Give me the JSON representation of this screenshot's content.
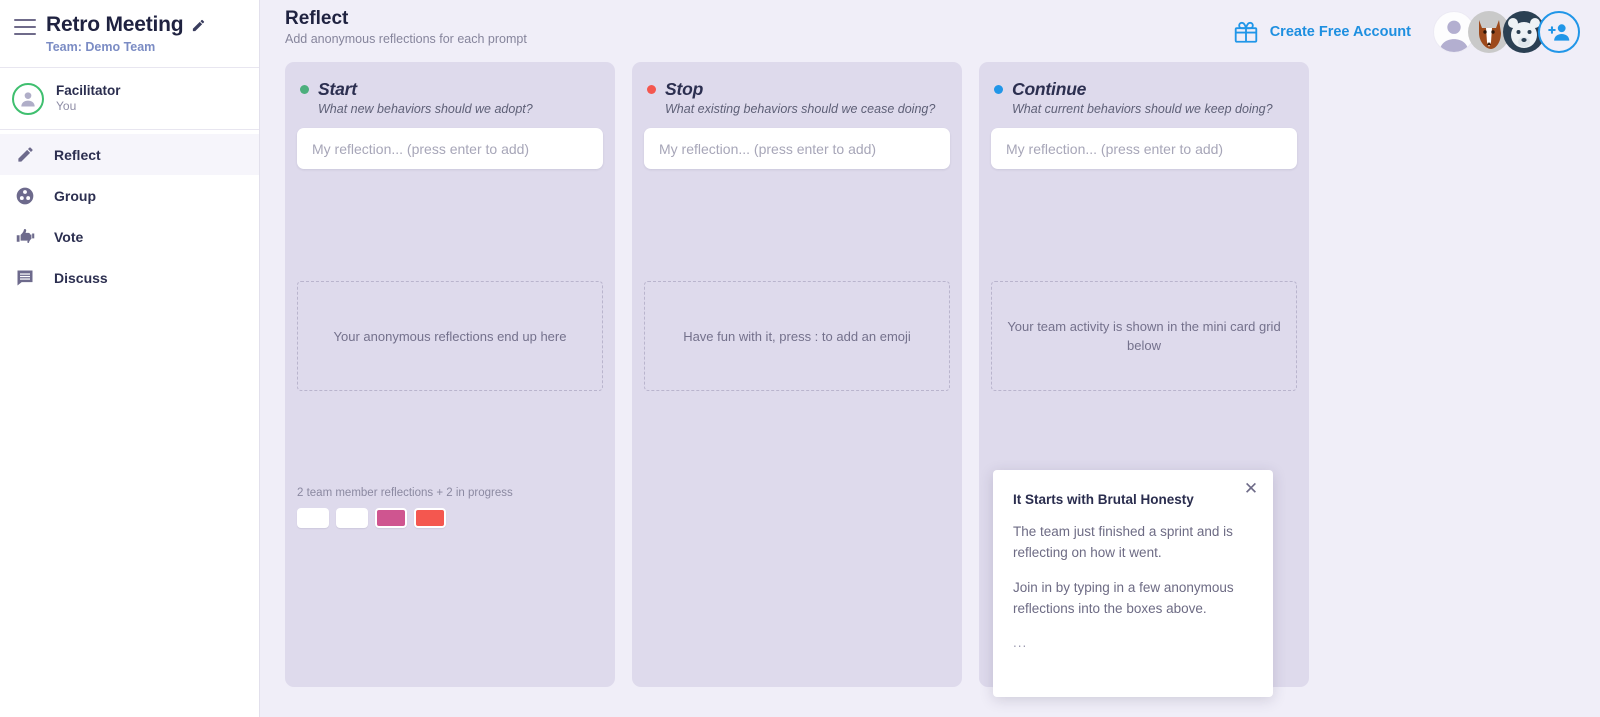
{
  "sidebar": {
    "menu_icon": "hamburger-icon",
    "retro_title": "Retro Meeting",
    "edit_icon": "pencil-icon",
    "team_line": "Team: Demo Team",
    "user": {
      "avatar_icon": "user-avatar-icon",
      "name": "Facilitator",
      "role": "You"
    },
    "nav": [
      {
        "label": "Reflect",
        "icon": "pencil-icon",
        "active": true
      },
      {
        "label": "Group",
        "icon": "group-icon",
        "active": false
      },
      {
        "label": "Vote",
        "icon": "thumbs-icon",
        "active": false
      },
      {
        "label": "Discuss",
        "icon": "comment-icon",
        "active": false
      }
    ]
  },
  "header": {
    "title": "Reflect",
    "subtitle": "Add anonymous reflections for each prompt",
    "cta_icon": "gift-icon",
    "cta_label": "Create Free Account",
    "avatars": [
      {
        "name": "avatar-generic-user"
      },
      {
        "name": "avatar-fox"
      },
      {
        "name": "avatar-polar-bear"
      }
    ],
    "add_person_icon": "add-person-icon"
  },
  "columns": [
    {
      "title": "Start",
      "prompt": "What new behaviors should we adopt?",
      "dot_color": "#4caf7d",
      "input_placeholder": "My reflection... (press enter to add)",
      "hint": "Your anonymous reflections end up here",
      "mini_count": "2 team member reflections + 2 in progress",
      "mini_cards": [
        "#ffffff",
        "#ffffff",
        "#cf5590",
        "#f4574f"
      ]
    },
    {
      "title": "Stop",
      "prompt": "What existing behaviors should we cease doing?",
      "dot_color": "#f4574f",
      "input_placeholder": "My reflection... (press enter to add)",
      "hint": "Have fun with it, press : to add an emoji",
      "mini_count": "",
      "mini_cards": []
    },
    {
      "title": "Continue",
      "prompt": "What current behaviors should we keep doing?",
      "dot_color": "#2196e8",
      "input_placeholder": "My reflection... (press enter to add)",
      "hint": "Your team activity is shown in the mini card grid below",
      "mini_count": "",
      "mini_cards": []
    }
  ],
  "popup": {
    "close_icon": "close-icon",
    "title": "It Starts with Brutal Honesty",
    "paragraph1": "The team just finished a sprint and is reflecting on how it went.",
    "paragraph2": "Join in by typing in a few anonymous reflections into the boxes above.",
    "dots": "..."
  },
  "colors": {
    "background": "#f0eef8",
    "column": "#dedaec",
    "accent_blue": "#2196e8",
    "sidebar_bg": "#ffffff",
    "title_text": "#1f2240"
  }
}
